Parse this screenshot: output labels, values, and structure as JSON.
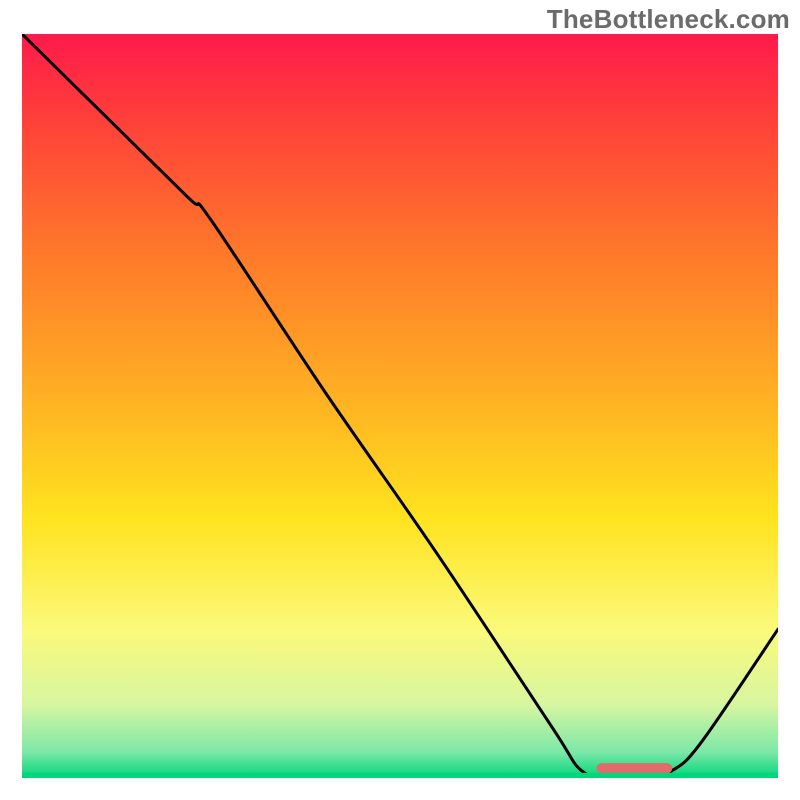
{
  "watermark": "TheBottleneck.com",
  "chart_data": {
    "type": "line",
    "title": "",
    "xlabel": "",
    "ylabel": "",
    "xlim": [
      0,
      100
    ],
    "ylim": [
      0,
      100
    ],
    "grid": false,
    "legend": false,
    "background_gradient": {
      "stops": [
        {
          "pos": 0.0,
          "color": "#ff1a4b"
        },
        {
          "pos": 0.1,
          "color": "#ff3b3b"
        },
        {
          "pos": 0.3,
          "color": "#ff7a2a"
        },
        {
          "pos": 0.5,
          "color": "#ffb423"
        },
        {
          "pos": 0.65,
          "color": "#ffe31e"
        },
        {
          "pos": 0.8,
          "color": "#fbf97a"
        },
        {
          "pos": 0.9,
          "color": "#d8f6a0"
        },
        {
          "pos": 0.965,
          "color": "#7de8a8"
        },
        {
          "pos": 1.0,
          "color": "#00d67a"
        }
      ]
    },
    "series": [
      {
        "name": "bottleneck-curve",
        "color": "#000000",
        "x": [
          0,
          10,
          22,
          25,
          40,
          55,
          70,
          74,
          78,
          82,
          86,
          90,
          100
        ],
        "y": [
          100,
          90,
          78,
          75,
          52,
          30,
          7,
          1,
          0,
          0,
          1,
          5,
          20
        ]
      }
    ],
    "marker": {
      "name": "optimal-range-marker",
      "shape": "rounded-bar",
      "color": "#e26a6a",
      "x_start": 76,
      "x_end": 86,
      "y": 0.6,
      "thickness": 1.4
    }
  }
}
